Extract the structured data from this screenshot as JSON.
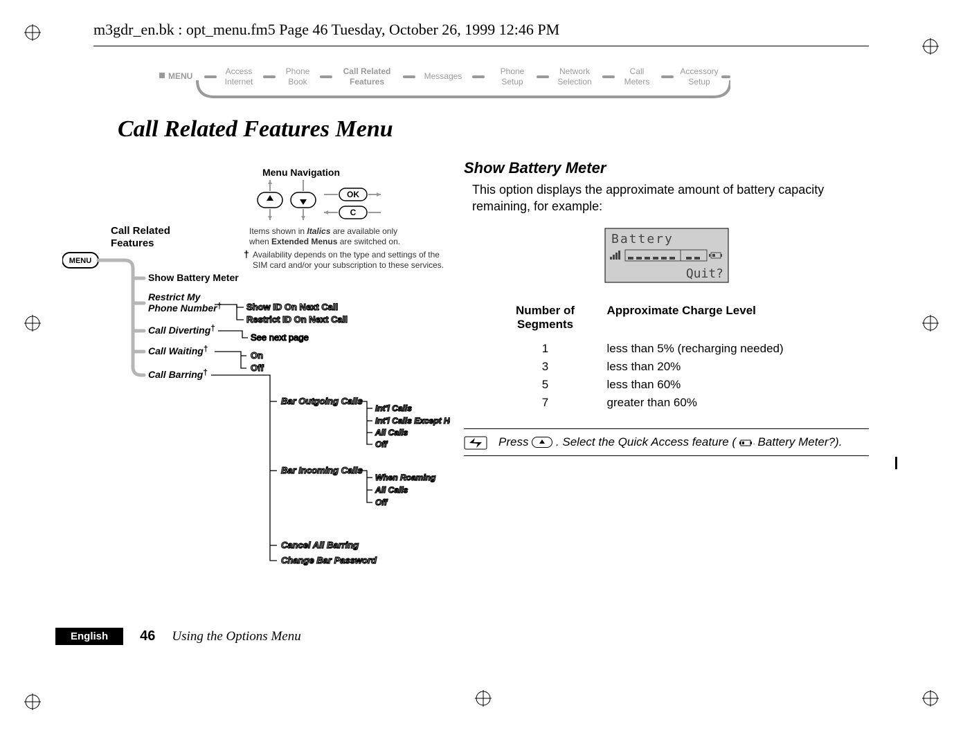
{
  "header": {
    "line": "m3gdr_en.bk : opt_menu.fm5  Page 46  Tuesday, October 26, 1999  12:46 PM"
  },
  "ribbon": {
    "menu": "MENU",
    "items": [
      {
        "top": "Access",
        "bottom": "Internet"
      },
      {
        "top": "Phone",
        "bottom": "Book"
      },
      {
        "top": "Call Related",
        "bottom": "Features",
        "active": true
      },
      {
        "top": "Messages",
        "bottom": ""
      },
      {
        "top": "Phone",
        "bottom": "Setup"
      },
      {
        "top": "Network",
        "bottom": "Selection"
      },
      {
        "top": "Call",
        "bottom": "Meters"
      },
      {
        "top": "Accessory",
        "bottom": "Setup"
      }
    ]
  },
  "title": "Call Related Features Menu",
  "diagram": {
    "nav_title": "Menu Navigation",
    "ok": "OK",
    "c": "C",
    "note_italics": "Items shown in Italics are available only when Extended Menus are switched on.",
    "note_dagger": "Availability depends on the type and settings of the SIM card and/or your subscription to these services.",
    "menu_btn": "MENU",
    "root": "Call Related\nFeatures",
    "items": {
      "show_battery": "Show Battery Meter",
      "restrict_my": "Restrict My\nPhone Number",
      "call_diverting": "Call Diverting",
      "call_waiting": "Call Waiting",
      "call_barring": "Call Barring",
      "show_id": "Show ID On Next Call",
      "restrict_id": "Restrict ID On Next Call",
      "see_next": "See next page",
      "on": "On",
      "off": "Off",
      "bar_out": "Bar Outgoing Calls",
      "bar_in": "Bar Incoming Calls",
      "cancel_all": "Cancel All Barring",
      "change_pw": "Change Bar Password",
      "intl": "Int'l Calls",
      "intl_home": "Int'l Calls Except Home",
      "all_calls": "All Calls",
      "roaming": "When Roaming"
    }
  },
  "right": {
    "heading": "Show Battery Meter",
    "body": "This option displays the approximate amount of battery capacity remaining, for example:",
    "lcd_title": "Battery",
    "lcd_quit": "Quit?",
    "table": {
      "h1": "Number of Segments",
      "h2": "Approximate Charge Level",
      "rows": [
        {
          "seg": "1",
          "lvl": "less than 5% (recharging needed)"
        },
        {
          "seg": "3",
          "lvl": "less than 20%"
        },
        {
          "seg": "5",
          "lvl": "less than 60%"
        },
        {
          "seg": "7",
          "lvl": "greater than 60%"
        }
      ]
    },
    "tip_prefix": "Press ",
    "tip_mid": ". Select the Quick Access feature (",
    "tip_label": " Battery Meter?).",
    "tip_icon_alt": "up-arrow key"
  },
  "footer": {
    "lang": "English",
    "page": "46",
    "section": "Using the Options Menu"
  }
}
